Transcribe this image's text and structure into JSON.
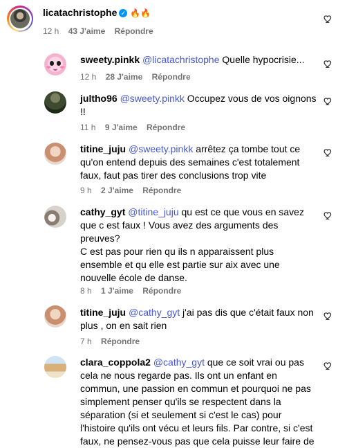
{
  "comments": [
    {
      "username": "licatachristophe",
      "verified": true,
      "text": "🔥🔥",
      "time": "12 h",
      "likes": "43 J'aime",
      "reply": "Répondre"
    },
    {
      "username": "sweety.pinkk",
      "mention": "@licatachristophe",
      "text": " Quelle hypocrisie...",
      "time": "12 h",
      "likes": "28 J'aime",
      "reply": "Répondre"
    },
    {
      "username": "jultho96",
      "mention": "@sweety.pinkk",
      "text": " Occupez vous de vos oignons !!",
      "time": "11 h",
      "likes": "9 J'aime",
      "reply": "Répondre"
    },
    {
      "username": "titine_juju",
      "mention": "@sweety.pinkk",
      "text": " arrêtez ça tombe tout ce qu'on entend depuis des semaines c'est totalement faux, faut pas tirer des conclusions trop vite",
      "time": "9 h",
      "likes": "2 J'aime",
      "reply": "Répondre"
    },
    {
      "username": "cathy_gyt",
      "mention": "@titine_juju",
      "text": " qu est ce que vous en savez que c est faux ! Vous avez des arguments des preuves?\nC est pas pour rien qu ils n apparaissent plus ensemble et qu elle est partie sur aix avec une nouvelle école de danse.",
      "time": "8 h",
      "likes": "1 J'aime",
      "reply": "Répondre"
    },
    {
      "username": "titine_juju",
      "mention": "@cathy_gyt",
      "text": " j'ai pas dis que c'était faux non plus , on en sait rien",
      "time": "7 h",
      "likes": "",
      "reply": "Répondre"
    },
    {
      "username": "clara_coppola2",
      "mention": "@cathy_gyt",
      "text": " que ce soit vrai ou pas cela ne nous regarde pas. Ils ont un enfant en commun, une passion en commun et pourquoi ne pas simplement penser qu'ils se respectent dans la séparation (si et seulement si c'est le cas) pour l'histoire qu'ils ont vécu et leurs fils. Par contre, si c'est faux, ne pensez-vous pas que cela puisse leur faire de",
      "time": "",
      "likes": "",
      "reply": ""
    }
  ],
  "icons": {
    "like": "heart-outline-icon",
    "verified": "verified-badge-icon"
  },
  "colors": {
    "mention": "#4558d6",
    "meta": "#737373",
    "verified": "#0095f6"
  }
}
